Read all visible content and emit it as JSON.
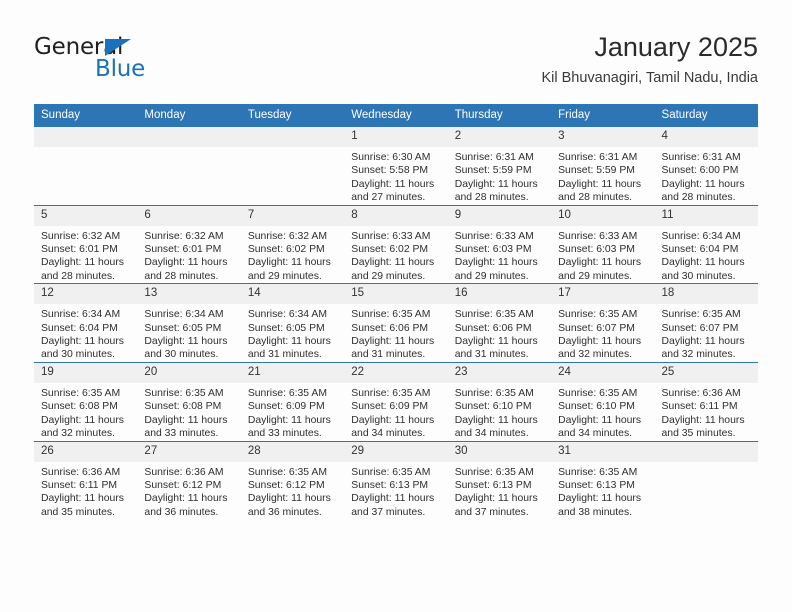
{
  "brand": {
    "name_part1": "General",
    "name_part2": "Blue",
    "triangle_color": "#1a72ba",
    "text_color": "#231f20"
  },
  "header": {
    "title": "January 2025",
    "subtitle": "Kil Bhuvanagiri, Tamil Nadu, India"
  },
  "theme": {
    "header_blue": "#2e75b6",
    "daynum_band": "#f0f0f0",
    "page_background": "#fdfdfd",
    "text_color": "#2f2f2f"
  },
  "weekday_headers": [
    "Sunday",
    "Monday",
    "Tuesday",
    "Wednesday",
    "Thursday",
    "Friday",
    "Saturday"
  ],
  "labels": {
    "sunrise_prefix": "Sunrise:",
    "sunset_prefix": "Sunset:",
    "daylight_prefix": "Daylight:"
  },
  "weeks": [
    [
      {
        "day": "",
        "empty": true,
        "line1": "",
        "line2": "",
        "line3": "",
        "line4": ""
      },
      {
        "day": "",
        "empty": true,
        "line1": "",
        "line2": "",
        "line3": "",
        "line4": ""
      },
      {
        "day": "",
        "empty": true,
        "line1": "",
        "line2": "",
        "line3": "",
        "line4": ""
      },
      {
        "day": "1",
        "empty": false,
        "line1": "Sunrise: 6:30 AM",
        "line2": "Sunset: 5:58 PM",
        "line3": "Daylight: 11 hours",
        "line4": "and 27 minutes."
      },
      {
        "day": "2",
        "empty": false,
        "line1": "Sunrise: 6:31 AM",
        "line2": "Sunset: 5:59 PM",
        "line3": "Daylight: 11 hours",
        "line4": "and 28 minutes."
      },
      {
        "day": "3",
        "empty": false,
        "line1": "Sunrise: 6:31 AM",
        "line2": "Sunset: 5:59 PM",
        "line3": "Daylight: 11 hours",
        "line4": "and 28 minutes."
      },
      {
        "day": "4",
        "empty": false,
        "line1": "Sunrise: 6:31 AM",
        "line2": "Sunset: 6:00 PM",
        "line3": "Daylight: 11 hours",
        "line4": "and 28 minutes."
      }
    ],
    [
      {
        "day": "5",
        "empty": false,
        "line1": "Sunrise: 6:32 AM",
        "line2": "Sunset: 6:01 PM",
        "line3": "Daylight: 11 hours",
        "line4": "and 28 minutes."
      },
      {
        "day": "6",
        "empty": false,
        "line1": "Sunrise: 6:32 AM",
        "line2": "Sunset: 6:01 PM",
        "line3": "Daylight: 11 hours",
        "line4": "and 28 minutes."
      },
      {
        "day": "7",
        "empty": false,
        "line1": "Sunrise: 6:32 AM",
        "line2": "Sunset: 6:02 PM",
        "line3": "Daylight: 11 hours",
        "line4": "and 29 minutes."
      },
      {
        "day": "8",
        "empty": false,
        "line1": "Sunrise: 6:33 AM",
        "line2": "Sunset: 6:02 PM",
        "line3": "Daylight: 11 hours",
        "line4": "and 29 minutes."
      },
      {
        "day": "9",
        "empty": false,
        "line1": "Sunrise: 6:33 AM",
        "line2": "Sunset: 6:03 PM",
        "line3": "Daylight: 11 hours",
        "line4": "and 29 minutes."
      },
      {
        "day": "10",
        "empty": false,
        "line1": "Sunrise: 6:33 AM",
        "line2": "Sunset: 6:03 PM",
        "line3": "Daylight: 11 hours",
        "line4": "and 29 minutes."
      },
      {
        "day": "11",
        "empty": false,
        "line1": "Sunrise: 6:34 AM",
        "line2": "Sunset: 6:04 PM",
        "line3": "Daylight: 11 hours",
        "line4": "and 30 minutes."
      }
    ],
    [
      {
        "day": "12",
        "empty": false,
        "line1": "Sunrise: 6:34 AM",
        "line2": "Sunset: 6:04 PM",
        "line3": "Daylight: 11 hours",
        "line4": "and 30 minutes."
      },
      {
        "day": "13",
        "empty": false,
        "line1": "Sunrise: 6:34 AM",
        "line2": "Sunset: 6:05 PM",
        "line3": "Daylight: 11 hours",
        "line4": "and 30 minutes."
      },
      {
        "day": "14",
        "empty": false,
        "line1": "Sunrise: 6:34 AM",
        "line2": "Sunset: 6:05 PM",
        "line3": "Daylight: 11 hours",
        "line4": "and 31 minutes."
      },
      {
        "day": "15",
        "empty": false,
        "line1": "Sunrise: 6:35 AM",
        "line2": "Sunset: 6:06 PM",
        "line3": "Daylight: 11 hours",
        "line4": "and 31 minutes."
      },
      {
        "day": "16",
        "empty": false,
        "line1": "Sunrise: 6:35 AM",
        "line2": "Sunset: 6:06 PM",
        "line3": "Daylight: 11 hours",
        "line4": "and 31 minutes."
      },
      {
        "day": "17",
        "empty": false,
        "line1": "Sunrise: 6:35 AM",
        "line2": "Sunset: 6:07 PM",
        "line3": "Daylight: 11 hours",
        "line4": "and 32 minutes."
      },
      {
        "day": "18",
        "empty": false,
        "line1": "Sunrise: 6:35 AM",
        "line2": "Sunset: 6:07 PM",
        "line3": "Daylight: 11 hours",
        "line4": "and 32 minutes."
      }
    ],
    [
      {
        "day": "19",
        "empty": false,
        "line1": "Sunrise: 6:35 AM",
        "line2": "Sunset: 6:08 PM",
        "line3": "Daylight: 11 hours",
        "line4": "and 32 minutes."
      },
      {
        "day": "20",
        "empty": false,
        "line1": "Sunrise: 6:35 AM",
        "line2": "Sunset: 6:08 PM",
        "line3": "Daylight: 11 hours",
        "line4": "and 33 minutes."
      },
      {
        "day": "21",
        "empty": false,
        "line1": "Sunrise: 6:35 AM",
        "line2": "Sunset: 6:09 PM",
        "line3": "Daylight: 11 hours",
        "line4": "and 33 minutes."
      },
      {
        "day": "22",
        "empty": false,
        "line1": "Sunrise: 6:35 AM",
        "line2": "Sunset: 6:09 PM",
        "line3": "Daylight: 11 hours",
        "line4": "and 34 minutes."
      },
      {
        "day": "23",
        "empty": false,
        "line1": "Sunrise: 6:35 AM",
        "line2": "Sunset: 6:10 PM",
        "line3": "Daylight: 11 hours",
        "line4": "and 34 minutes."
      },
      {
        "day": "24",
        "empty": false,
        "line1": "Sunrise: 6:35 AM",
        "line2": "Sunset: 6:10 PM",
        "line3": "Daylight: 11 hours",
        "line4": "and 34 minutes."
      },
      {
        "day": "25",
        "empty": false,
        "line1": "Sunrise: 6:36 AM",
        "line2": "Sunset: 6:11 PM",
        "line3": "Daylight: 11 hours",
        "line4": "and 35 minutes."
      }
    ],
    [
      {
        "day": "26",
        "empty": false,
        "line1": "Sunrise: 6:36 AM",
        "line2": "Sunset: 6:11 PM",
        "line3": "Daylight: 11 hours",
        "line4": "and 35 minutes."
      },
      {
        "day": "27",
        "empty": false,
        "line1": "Sunrise: 6:36 AM",
        "line2": "Sunset: 6:12 PM",
        "line3": "Daylight: 11 hours",
        "line4": "and 36 minutes."
      },
      {
        "day": "28",
        "empty": false,
        "line1": "Sunrise: 6:35 AM",
        "line2": "Sunset: 6:12 PM",
        "line3": "Daylight: 11 hours",
        "line4": "and 36 minutes."
      },
      {
        "day": "29",
        "empty": false,
        "line1": "Sunrise: 6:35 AM",
        "line2": "Sunset: 6:13 PM",
        "line3": "Daylight: 11 hours",
        "line4": "and 37 minutes."
      },
      {
        "day": "30",
        "empty": false,
        "line1": "Sunrise: 6:35 AM",
        "line2": "Sunset: 6:13 PM",
        "line3": "Daylight: 11 hours",
        "line4": "and 37 minutes."
      },
      {
        "day": "31",
        "empty": false,
        "line1": "Sunrise: 6:35 AM",
        "line2": "Sunset: 6:13 PM",
        "line3": "Daylight: 11 hours",
        "line4": "and 38 minutes."
      },
      {
        "day": "",
        "empty": true,
        "line1": "",
        "line2": "",
        "line3": "",
        "line4": ""
      }
    ]
  ]
}
